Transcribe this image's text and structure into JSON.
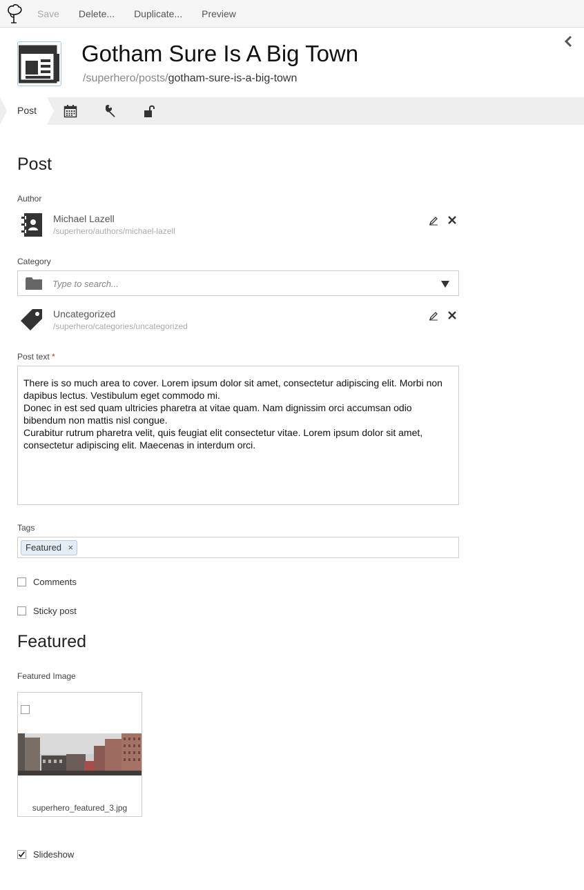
{
  "toolbar": {
    "save": "Save",
    "delete": "Delete...",
    "duplicate": "Duplicate...",
    "preview": "Preview"
  },
  "header": {
    "title": "Gotham Sure Is A Big Town",
    "path_prefix": "/superhero/posts/",
    "path_slug": "gotham-sure-is-a-big-town"
  },
  "tabs": {
    "active_label": "Post",
    "icons": [
      "calendar-icon",
      "wrench-icon",
      "unlock-icon"
    ]
  },
  "post_section": {
    "title": "Post",
    "author": {
      "label": "Author",
      "name": "Michael Lazell",
      "path": "/superhero/authors/michael-lazell"
    },
    "category": {
      "label": "Category",
      "placeholder": "Type to search...",
      "selected_name": "Uncategorized",
      "selected_path": "/superhero/categories/uncategorized"
    },
    "post_text": {
      "label": "Post text",
      "required_mark": "*",
      "paragraphs": [
        "There is so much area to cover. Lorem ipsum dolor sit amet, consectetur adipiscing elit. Morbi non dapibus lectus. Vestibulum eget commodo mi.",
        "Donec in est sed quam ultricies pharetra at vitae quam. Nam dignissim orci accumsan odio bibendum non mattis nisl congue.",
        "Curabitur rutrum pharetra velit, quis feugiat elit consectetur vitae. Lorem ipsum dolor sit amet, consectetur adipiscing elit. Maecenas in interdum orci."
      ]
    },
    "tags": {
      "label": "Tags",
      "items": [
        "Featured"
      ],
      "remove_glyph": "×"
    },
    "comments": {
      "label": "Comments",
      "checked": false
    },
    "sticky": {
      "label": "Sticky post",
      "checked": false
    }
  },
  "featured_section": {
    "title": "Featured",
    "image_label": "Featured Image",
    "image_filename": "superhero_featured_3.jpg",
    "slideshow": {
      "label": "Slideshow",
      "checked": true
    }
  },
  "colors": {
    "tab_bar": "#eeeeee",
    "icon_dark": "#333333",
    "selected_border": "#9fc6e8"
  }
}
